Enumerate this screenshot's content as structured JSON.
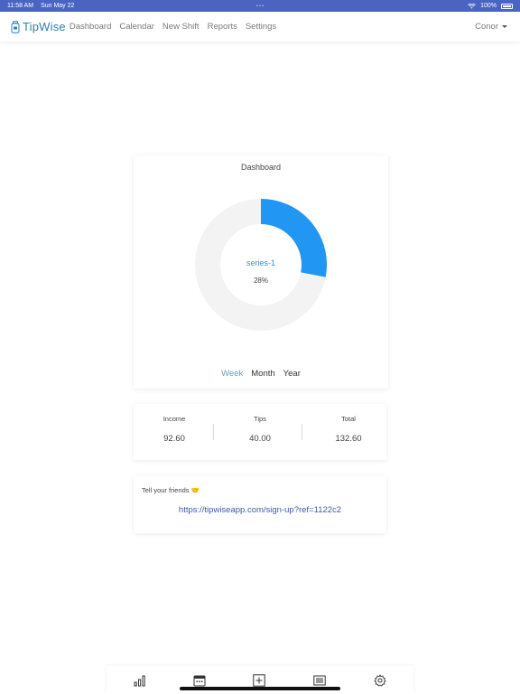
{
  "status_bar": {
    "time": "11:58 AM",
    "date": "Sun May 22",
    "center": "• • •",
    "battery": "100%"
  },
  "navbar": {
    "brand": "TipWise",
    "links": [
      "Dashboard",
      "Calendar",
      "New Shift",
      "Reports",
      "Settings"
    ],
    "user": "Conor"
  },
  "dashboard": {
    "title": "Dashboard",
    "series_label": "series-1",
    "percent_label": "28%",
    "tabs": [
      "Week",
      "Month",
      "Year"
    ],
    "active_tab": "Week"
  },
  "chart_data": {
    "type": "pie",
    "series": [
      {
        "name": "series-1",
        "values": [
          28
        ]
      }
    ],
    "percent": 28,
    "title": "Dashboard"
  },
  "stats": {
    "income_label": "Income",
    "income_value": "92.60",
    "tips_label": "Tips",
    "tips_value": "40.00",
    "total_label": "Total",
    "total_value": "132.60"
  },
  "share": {
    "title": "Tell your friends 🤝",
    "link": "https://tipwiseapp.com/sign-up?ref=1122c2"
  },
  "tabbar": {
    "icons": [
      "bar-chart-icon",
      "calendar-icon",
      "add-shift-icon",
      "list-icon",
      "gear-icon"
    ]
  },
  "colors": {
    "accent": "#2196f3",
    "track": "#f3f3f3",
    "brand": "#2e7fb0",
    "status_bar": "#4a64c4",
    "link": "#3b5ba9",
    "active_tab": "#6aa0b8"
  }
}
